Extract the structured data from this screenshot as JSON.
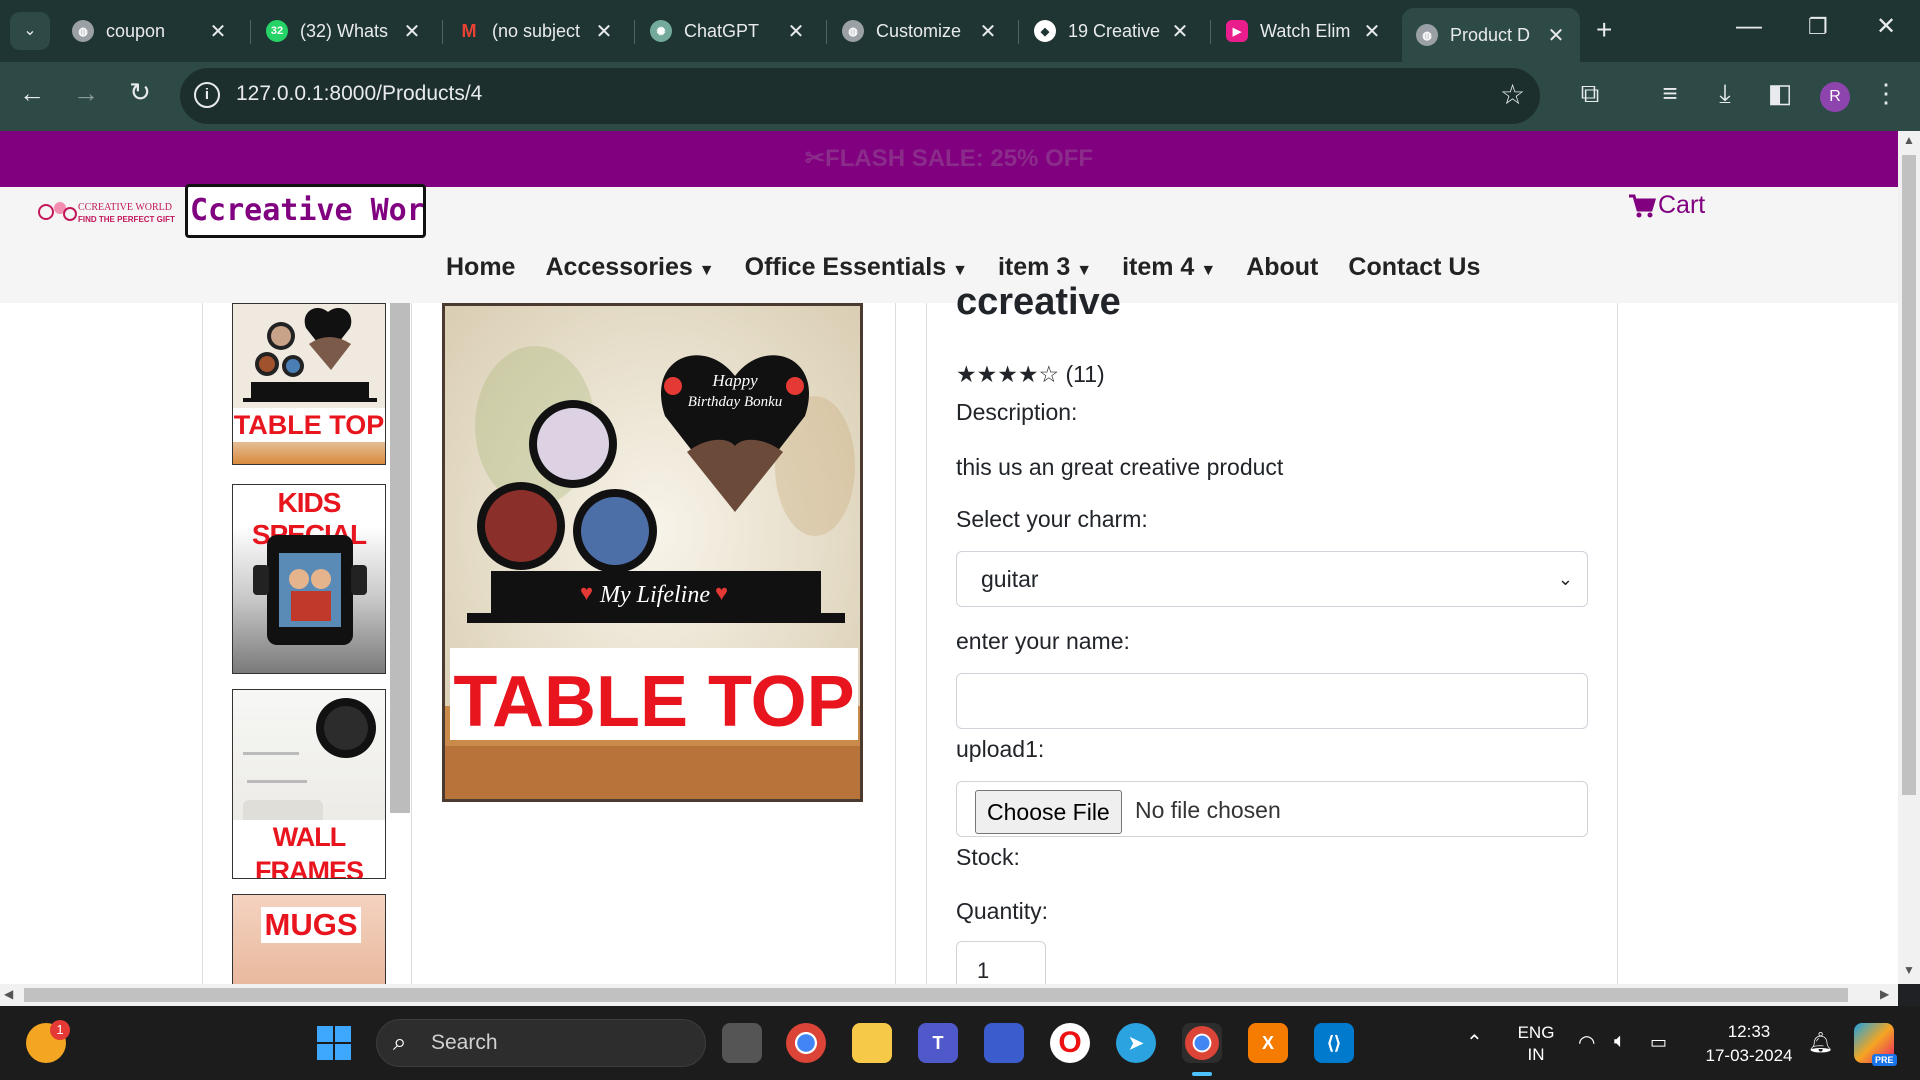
{
  "browser": {
    "tabs": [
      {
        "title": "coupon",
        "icon": "globe-icon",
        "color": "#5f6368",
        "badge": ""
      },
      {
        "title": "(32) Whats",
        "icon": "whatsapp-icon",
        "color": "#25d366",
        "badge": "32"
      },
      {
        "title": "(no subject",
        "icon": "gmail-icon",
        "color": "#ea4335",
        "badge": "M"
      },
      {
        "title": "ChatGPT",
        "icon": "chatgpt-icon",
        "color": "#74aa9c",
        "badge": ""
      },
      {
        "title": "Customize",
        "icon": "globe-icon",
        "color": "#5f6368",
        "badge": ""
      },
      {
        "title": "19 Creative",
        "icon": "code-icon",
        "color": "#2e4a47",
        "badge": ""
      },
      {
        "title": "Watch Elim",
        "icon": "video-icon",
        "color": "#e91e8c",
        "badge": ""
      },
      {
        "title": "Product D",
        "icon": "globe-icon",
        "color": "#5f6368",
        "badge": ""
      }
    ],
    "active_tab_index": 7,
    "url": "127.0.0.1:8000/Products/4",
    "profile_initial": "R"
  },
  "page": {
    "flash_sale": "✂FLASH SALE: 25% OFF",
    "brand_name": "Ccreative World",
    "logo_text_1": "CCREATIVE WORLD",
    "logo_text_2": "FIND THE PERFECT GIFT",
    "cart_label": "Cart",
    "nav": [
      {
        "label": "Home",
        "dropdown": false
      },
      {
        "label": "Accessories",
        "dropdown": true
      },
      {
        "label": "Office Essentials",
        "dropdown": true
      },
      {
        "label": "item 3",
        "dropdown": true
      },
      {
        "label": "item 4",
        "dropdown": true
      },
      {
        "label": "About",
        "dropdown": false
      },
      {
        "label": "Contact Us",
        "dropdown": false
      }
    ],
    "thumbnails": [
      "TABLE TOP",
      "KIDS SPECIAL",
      "WALL FRAMES",
      "MUGS"
    ],
    "main_image": {
      "caption": "TABLE TOP",
      "heart_text_1": "Happy",
      "heart_text_2": "Birthday Bonku",
      "plaque_text": "My Lifeline"
    },
    "product": {
      "name": "ccreative",
      "stars": "★★★★☆",
      "rating": 4,
      "review_count": "(11)",
      "description_label": "Description:",
      "description": "this us an great creative product",
      "charm_label": "Select your charm:",
      "charm_value": "guitar",
      "name_label": "enter your name:",
      "name_value": "",
      "upload_label": "upload1:",
      "choose_file": "Choose File",
      "no_file": "No file chosen",
      "stock_label": "Stock:",
      "quantity_label": "Quantity:",
      "quantity_value": "1"
    }
  },
  "taskbar": {
    "search_placeholder": "Search",
    "weather_badge": "1",
    "language": "ENG",
    "region": "IN",
    "time": "12:33",
    "date": "17-03-2024",
    "pre_badge": "PRE"
  }
}
